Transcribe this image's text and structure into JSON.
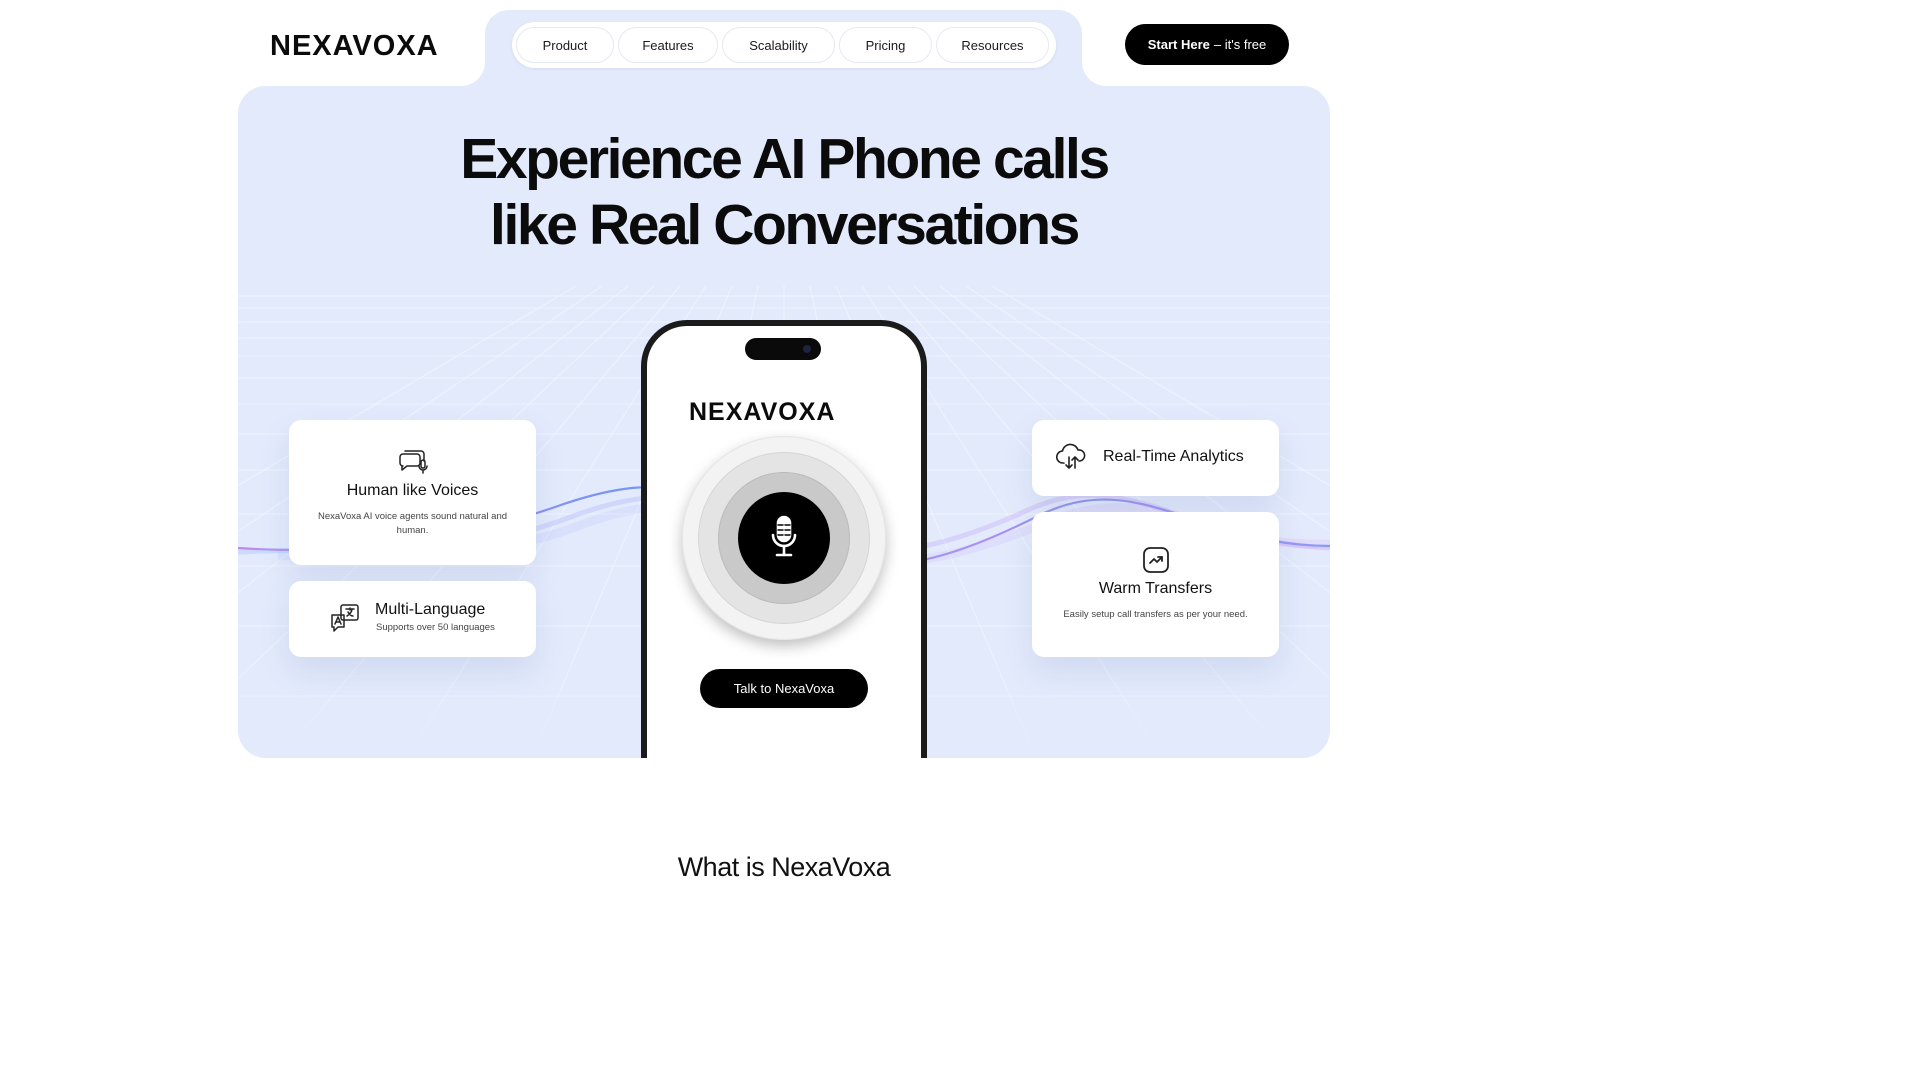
{
  "brand": {
    "name": "NEXAVOXA"
  },
  "nav": {
    "items": [
      {
        "label": "Product"
      },
      {
        "label": "Features"
      },
      {
        "label": "Scalability"
      },
      {
        "label": "Pricing"
      },
      {
        "label": "Resources"
      }
    ]
  },
  "cta": {
    "strong": "Start Here",
    "light": "– it's free"
  },
  "hero": {
    "title_line1": "Experience AI Phone calls",
    "title_line2": "like Real Conversations"
  },
  "features": {
    "voices": {
      "title": "Human like Voices",
      "desc": "NexaVoxa AI voice agents sound natural and human.",
      "icon": "voice-chat-icon"
    },
    "language": {
      "title": "Multi-Language",
      "desc": "Supports over 50 languages",
      "icon": "translate-icon"
    },
    "analytics": {
      "title": "Real-Time Analytics",
      "icon": "cloud-sync-icon"
    },
    "transfers": {
      "title": "Warm Transfers",
      "desc": "Easily setup call transfers as per your need.",
      "icon": "trend-up-icon"
    }
  },
  "phone": {
    "talk_label": "Talk to NexaVoxa",
    "mic_icon": "microphone-icon"
  },
  "section": {
    "title": "What is NexaVoxa"
  }
}
